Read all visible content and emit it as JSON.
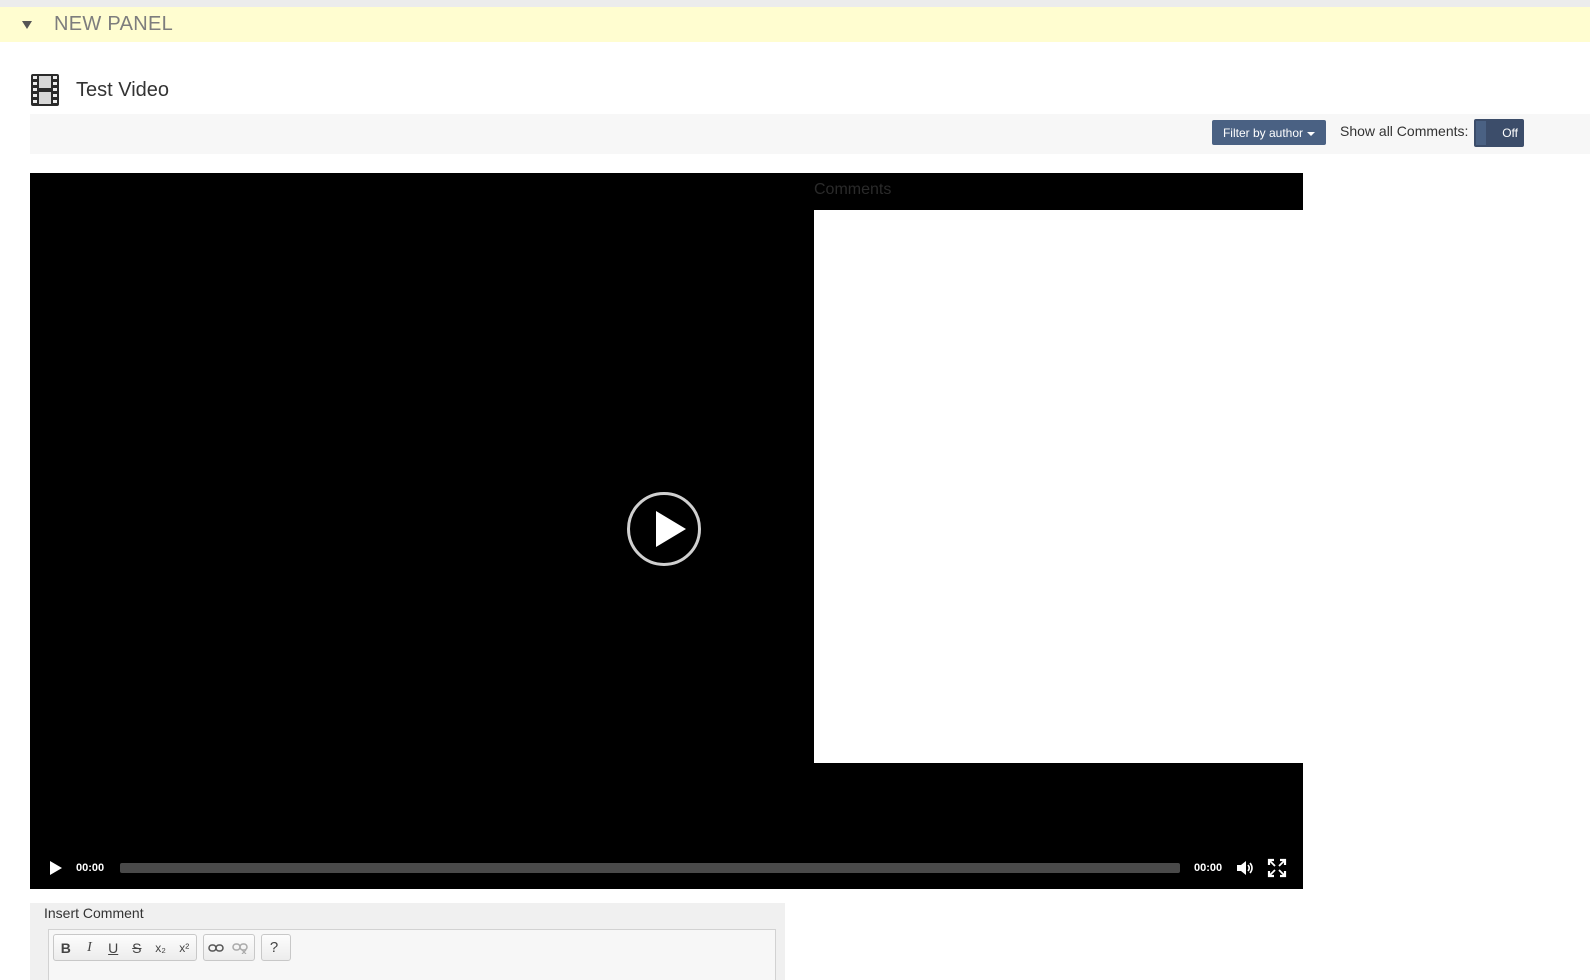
{
  "panel": {
    "title": "NEW PANEL"
  },
  "video": {
    "title": "Test Video"
  },
  "toolbar": {
    "filter_label": "Filter by author",
    "show_comments_label": "Show all Comments:",
    "toggle_state": "Off"
  },
  "player": {
    "comments_heading": "Comments",
    "current_time": "00:00",
    "duration": "00:00",
    "progress": 0
  },
  "editor": {
    "insert_label": "Insert Comment",
    "buttons": {
      "bold": "B",
      "italic": "I",
      "underline": "U",
      "strike": "S",
      "subscript": "x₂",
      "superscript": "x²",
      "help": "?"
    }
  },
  "colors": {
    "panel_header_bg": "#fffdd0",
    "primary_button": "#4a6183",
    "player_bg": "#000000"
  }
}
